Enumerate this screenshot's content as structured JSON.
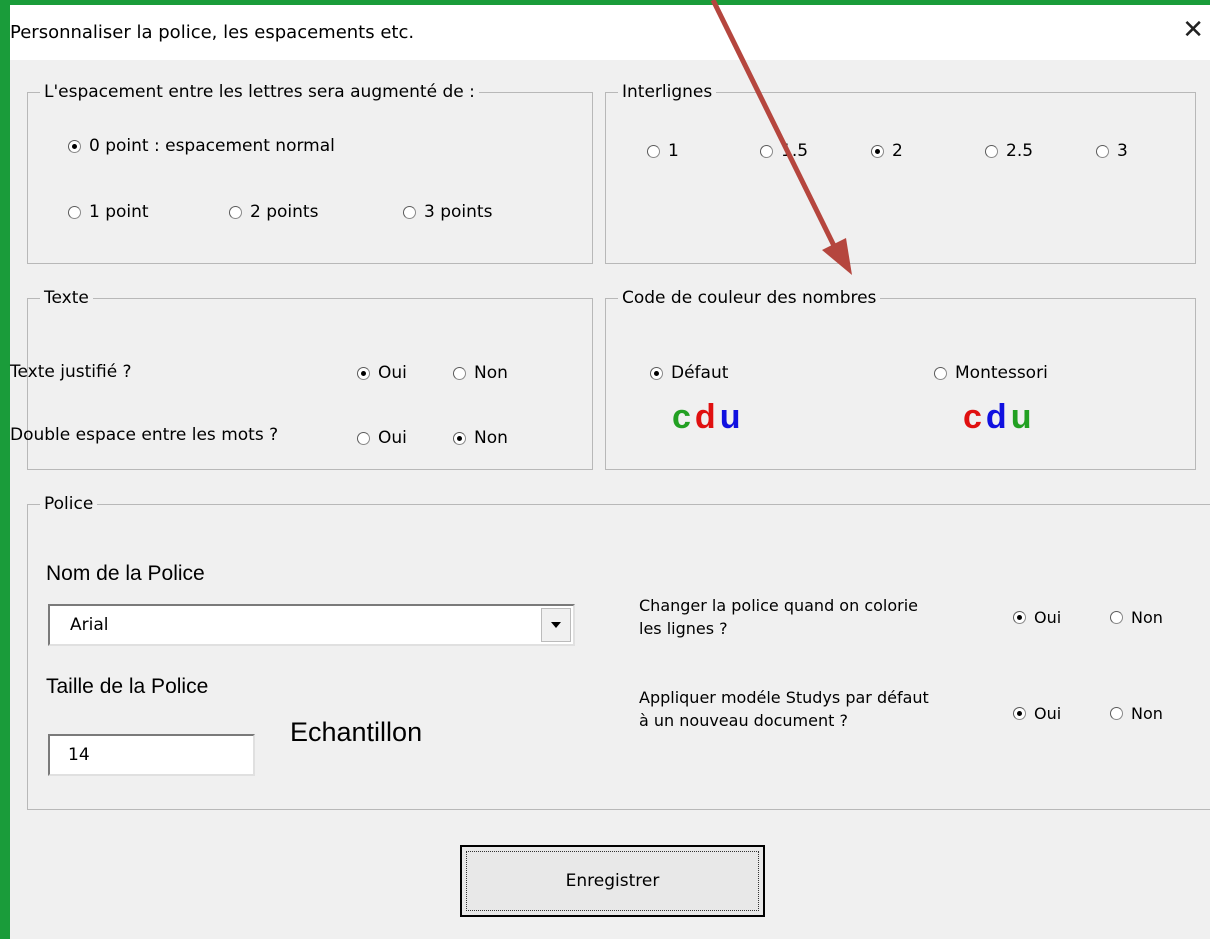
{
  "dialog": {
    "title": "Personnaliser  la police, les espacements etc.",
    "close_glyph": "✕"
  },
  "spacing": {
    "legend": "L'espacement entre les lettres sera augmenté de :",
    "options": [
      {
        "label": "0 point : espacement normal",
        "checked": true
      },
      {
        "label": "1 point",
        "checked": false
      },
      {
        "label": "2 points",
        "checked": false
      },
      {
        "label": "3 points",
        "checked": false
      }
    ]
  },
  "interlignes": {
    "legend": "Interlignes",
    "options": [
      {
        "label": "1",
        "checked": false
      },
      {
        "label": "1.5",
        "checked": false
      },
      {
        "label": "2",
        "checked": true
      },
      {
        "label": "2.5",
        "checked": false
      },
      {
        "label": "3",
        "checked": false
      }
    ]
  },
  "texte": {
    "legend": "Texte",
    "justified_label": "Texte justifié ?",
    "justified_yes": "Oui",
    "justified_no": "Non",
    "double_label": "Double espace entre les mots ?",
    "double_yes": "Oui",
    "double_no": "Non",
    "justified_value": "Oui",
    "double_value": "Non"
  },
  "couleur": {
    "legend": "Code de couleur des nombres",
    "default_label": "Défaut",
    "montessori_label": "Montessori",
    "selected": "Défaut",
    "default_letters": [
      {
        "char": "c",
        "color": "#22a022"
      },
      {
        "char": "d",
        "color": "#e01010"
      },
      {
        "char": "u",
        "color": "#1010e0"
      }
    ],
    "montessori_letters": [
      {
        "char": "c",
        "color": "#e01010"
      },
      {
        "char": "d",
        "color": "#1010e0"
      },
      {
        "char": "u",
        "color": "#22a022"
      }
    ]
  },
  "police": {
    "legend": "Police",
    "name_label": "Nom de la Police",
    "name_value": "Arial",
    "size_label": "Taille de la Police",
    "size_value": "14",
    "sample": "Echantillon",
    "change_label_1": "Changer la police quand on colorie",
    "change_label_2": "les lignes ?",
    "change_yes": "Oui",
    "change_no": "Non",
    "change_value": "Oui",
    "apply_label_1": "Appliquer modéle Studys par défaut",
    "apply_label_2": "à un nouveau document ?",
    "apply_yes": "Oui",
    "apply_no": "Non",
    "apply_value": "Oui"
  },
  "save_button": "Enregistrer",
  "colors": {
    "border_green": "#1a9c3a",
    "arrow_red": "#b5463e"
  }
}
